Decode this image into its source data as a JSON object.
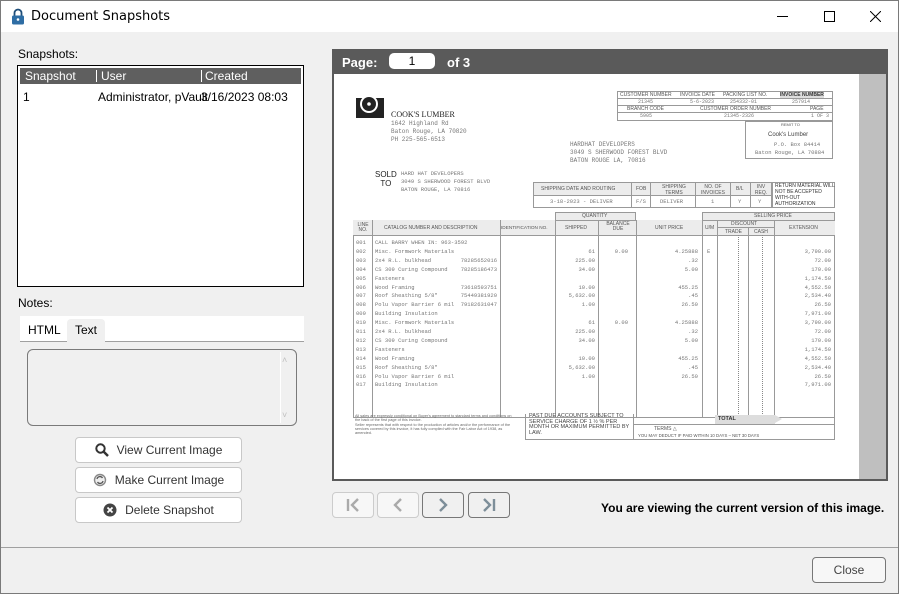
{
  "window": {
    "title": "Document Snapshots",
    "icon": "lock-icon"
  },
  "snapshots": {
    "label": "Snapshots:",
    "columns": [
      "Snapshot",
      "User",
      "Created"
    ],
    "rows": [
      {
        "snapshot": "1",
        "user": "Administrator, pVault",
        "created": "3/16/2023 08:03"
      }
    ]
  },
  "notes": {
    "label": "Notes:",
    "tabs": [
      "HTML",
      "Text"
    ],
    "selected_tab": "Text",
    "value": ""
  },
  "actions": {
    "view": "View Current Image",
    "make": "Make Current Image",
    "delete": "Delete Snapshot"
  },
  "viewer": {
    "page_label": "Page:",
    "page": "1",
    "of_label": "of 3"
  },
  "invoice": {
    "company": "COOK'S LUMBER",
    "company_addr": [
      "1642 Highland Rd",
      "Baton Rouge, LA 70820",
      "PH 225-565-6513"
    ],
    "header_cols": [
      "CUSTOMER NUMBER",
      "INVOICE DATE",
      "PACKING LIST NO.",
      "INVOICE NUMBER"
    ],
    "header_vals": [
      "21345",
      "5-6-2023",
      "254332-01",
      "257914"
    ],
    "header2_cols": [
      "BRANCH CODE",
      "CUSTOMER ORDER NUMBER",
      "PAGE"
    ],
    "header2_vals": [
      "5905",
      "21345-2326",
      "1 OF 3"
    ],
    "remit_label": "REMIT TO",
    "remit_name": "Cook's Lumber",
    "remit_addr": [
      "P.O. Box 84414",
      "Baton Rouge, LA 70884"
    ],
    "ship_to": [
      "HARDHAT DEVELOPERS",
      "3049 S SHERWOOD FOREST BLVD",
      "BATON ROUGE LA, 70816"
    ],
    "sold_to_label": [
      "SOLD",
      "TO"
    ],
    "sold_to": [
      "HARD HAT DEVELOPERS",
      "3049 S SHERWOOD FOREST BLVD",
      "BATON ROUGE, LA 70816"
    ],
    "ship_cols": [
      "SHIPPING DATE AND ROUTING",
      "FOB",
      "SHIPPING TERMS",
      "NO. OF INVOICES",
      "B/L",
      "INV REQ."
    ],
    "ship_vals": [
      "3-18-2023 - DELIVER",
      "F/S",
      "DELIVER",
      "1",
      "Y",
      "Y"
    ],
    "return_note": "RETURN MATERIAL WILL NOT BE ACCEPTED WITH-OUT AUTHORIZATION",
    "table_cols": [
      "LINE NO.",
      "CATALOG NUMBER AND DESCRIPTION",
      "IDENTIFICATION NO.",
      "SHIPPED",
      "BALANCE DUE",
      "UNIT PRICE",
      "U/M",
      "TRADE",
      "CASH",
      "EXTENSION"
    ],
    "group_quantity": "QUANTITY",
    "group_selling": "SELLING PRICE",
    "group_discount": "DISCOUNT",
    "lines": [
      {
        "no": "001",
        "desc": "CALL BARRY WHEN IN: 963-3592",
        "id": "",
        "shipped": "",
        "bal": "",
        "unit": "",
        "um": "",
        "ext": ""
      },
      {
        "no": "002",
        "desc": "Misc. Formwork Materials",
        "id": "",
        "shipped": "61",
        "bal": "0.00",
        "unit": "4.25888",
        "um": "E",
        "ext": "3,790.00"
      },
      {
        "no": "003",
        "desc": "2x4 R.L. bulkhead",
        "id": "78285652016",
        "shipped": "225.00",
        "bal": "",
        "unit": ".32",
        "um": "",
        "ext": "72.00"
      },
      {
        "no": "004",
        "desc": "CS 309 Curing Compound",
        "id": "78285186473",
        "shipped": "34.00",
        "bal": "",
        "unit": "5.00",
        "um": "",
        "ext": "170.00"
      },
      {
        "no": "005",
        "desc": "Fasteners",
        "id": "",
        "shipped": "",
        "bal": "",
        "unit": "",
        "um": "",
        "ext": "1,174.50"
      },
      {
        "no": "006",
        "desc": "Wood Framing",
        "id": "73618593751",
        "shipped": "10.00",
        "bal": "",
        "unit": "455.25",
        "um": "",
        "ext": "4,552.50"
      },
      {
        "no": "007",
        "desc": "Roof Sheathing 5/8\"",
        "id": "75449381920",
        "shipped": "5,632.00",
        "bal": "",
        "unit": ".45",
        "um": "",
        "ext": "2,534.40"
      },
      {
        "no": "008",
        "desc": "Polu Vapor Barrier 6 mil",
        "id": "79182631047",
        "shipped": "1.00",
        "bal": "",
        "unit": "26.50",
        "um": "",
        "ext": "26.50"
      },
      {
        "no": "009",
        "desc": "Building Insulation",
        "id": "",
        "shipped": "",
        "bal": "",
        "unit": "",
        "um": "",
        "ext": "7,971.00"
      },
      {
        "no": "010",
        "desc": "Misc. Formwork Materials",
        "id": "",
        "shipped": "61",
        "bal": "0.00",
        "unit": "4.25888",
        "um": "",
        "ext": "3,790.00"
      },
      {
        "no": "011",
        "desc": "2x4 R.L. bulkhead",
        "id": "",
        "shipped": "225.00",
        "bal": "",
        "unit": ".32",
        "um": "",
        "ext": "72.00"
      },
      {
        "no": "012",
        "desc": "CS 309 Curing Compound",
        "id": "",
        "shipped": "34.00",
        "bal": "",
        "unit": "5.00",
        "um": "",
        "ext": "170.00"
      },
      {
        "no": "013",
        "desc": "Fasteners",
        "id": "",
        "shipped": "",
        "bal": "",
        "unit": "",
        "um": "",
        "ext": "1,174.50"
      },
      {
        "no": "014",
        "desc": "Wood Framing",
        "id": "",
        "shipped": "10.00",
        "bal": "",
        "unit": "455.25",
        "um": "",
        "ext": "4,552.50"
      },
      {
        "no": "015",
        "desc": "Roof Sheathing 5/8\"",
        "id": "",
        "shipped": "5,632.00",
        "bal": "",
        "unit": ".45",
        "um": "",
        "ext": "2,534.40"
      },
      {
        "no": "016",
        "desc": "Polu Vapor Barrier 6 mil",
        "id": "",
        "shipped": "1.00",
        "bal": "",
        "unit": "26.50",
        "um": "",
        "ext": "26.50"
      },
      {
        "no": "017",
        "desc": "Building Insulation",
        "id": "",
        "shipped": "",
        "bal": "",
        "unit": "",
        "um": "",
        "ext": "7,971.00"
      }
    ],
    "fine_print": [
      "All sales are expressly conditional on Buyer's agreement to standard terms and conditions on",
      "the back of the first page of this invoice.",
      "Seller represents that with respect to the production of articles and/or the performance of the",
      "services covered by this invoice, it has fully complied with the Fair Labor Act of 1938, as",
      "amended."
    ],
    "past_due": [
      "PAST DUE ACCOUNTS SUBJECT TO",
      "SERVICE CHARGE OF 1 ½ % PER",
      "MONTH OR MAXIMUM PERMITTED BY",
      "LAW."
    ],
    "total_label": "TOTAL",
    "terms_label": "TERMS",
    "terms_text": "YOU MAY DEDUCT IF PAID WITHIN 10 DAYS – NET 30 DAYS"
  },
  "nav": {
    "first": "first-page",
    "prev": "previous-page",
    "next": "next-page",
    "last": "last-page"
  },
  "status": "You are viewing the current version of this image.",
  "close_label": "Close"
}
